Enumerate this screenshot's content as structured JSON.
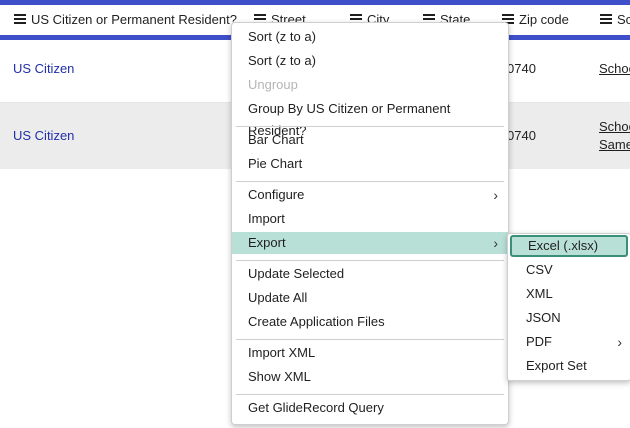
{
  "columns": [
    {
      "label": "US Citizen or Permanent Resident?"
    },
    {
      "label": "Street"
    },
    {
      "label": "City"
    },
    {
      "label": "State"
    },
    {
      "label": "Zip code"
    },
    {
      "label": "Sc"
    }
  ],
  "rows": [
    {
      "citizen": "US Citizen",
      "zip": "0740",
      "school": "Schoo",
      "school2": ""
    },
    {
      "citizen": "US Citizen",
      "zip": "0740",
      "school": "Schoo",
      "school2": "Same"
    }
  ],
  "menu": {
    "items": [
      {
        "label": "Sort (z to a)"
      },
      {
        "label": "Sort (z to a)"
      },
      {
        "label": "Ungroup"
      },
      {
        "label": "Group By US Citizen or Permanent Resident?"
      },
      {
        "label": "Bar Chart"
      },
      {
        "label": "Pie Chart"
      },
      {
        "label": "Configure"
      },
      {
        "label": "Import"
      },
      {
        "label": "Export"
      },
      {
        "label": "Update Selected"
      },
      {
        "label": "Update All"
      },
      {
        "label": "Create Application Files"
      },
      {
        "label": "Import XML"
      },
      {
        "label": "Show XML"
      },
      {
        "label": "Get GlideRecord Query"
      }
    ]
  },
  "export_submenu": {
    "items": [
      {
        "label": "Excel (.xlsx)"
      },
      {
        "label": "CSV"
      },
      {
        "label": "XML"
      },
      {
        "label": "JSON"
      },
      {
        "label": "PDF"
      },
      {
        "label": "Export Set"
      }
    ]
  },
  "colors": {
    "accent": "#3f4fc9",
    "highlight": "#b9e0d6",
    "link": "#2230a8"
  }
}
